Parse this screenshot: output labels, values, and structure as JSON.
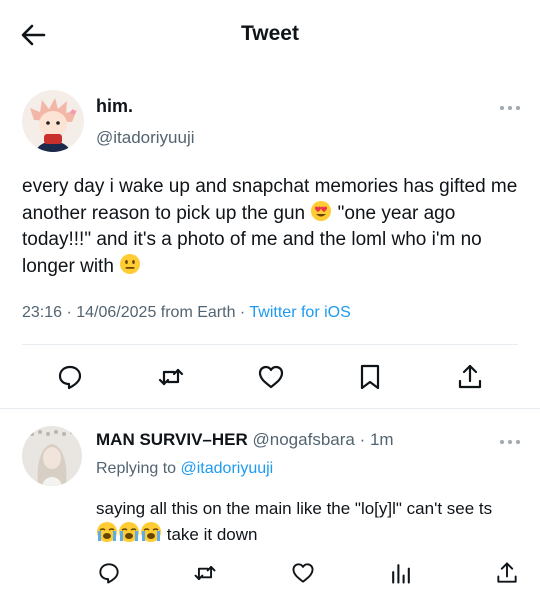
{
  "header": {
    "title": "Tweet"
  },
  "tweet": {
    "author": {
      "name": "him.",
      "handle": "@itadoriyuuji"
    },
    "text_parts": [
      "every day i wake up and snapchat memories has gifted me another reason to pick up the gun",
      "\"one year ago today!!!\" and it's a photo of me and the loml who i'm no longer with"
    ],
    "emoji_1": "heart-eyes-emoji",
    "emoji_2": "neutral-face-emoji",
    "time": "23:16 · 14/06/2025 from Earth",
    "separator": " · ",
    "source": "Twitter for iOS",
    "actions": [
      "reply-icon",
      "retweet-icon",
      "like-icon",
      "bookmark-icon",
      "share-icon"
    ]
  },
  "reply": {
    "author": {
      "name": "MAN SURVIV–HER",
      "handle": "@nogafsbara",
      "time_sep": " · ",
      "time": "1m"
    },
    "replying_label": "Replying to",
    "replying_handle": "@itadoriyuuji",
    "text_part1": "saying all this on the main like the \"lo[y]l\" can't see ts",
    "text_part2": "take it down",
    "emoji": "loudly-crying-emoji",
    "actions": [
      "reply-icon",
      "retweet-icon",
      "like-icon",
      "views-icon",
      "share-icon"
    ]
  },
  "colors": {
    "link": "#1d9bf0",
    "muted": "#536471",
    "divider": "#e6ecf0"
  }
}
